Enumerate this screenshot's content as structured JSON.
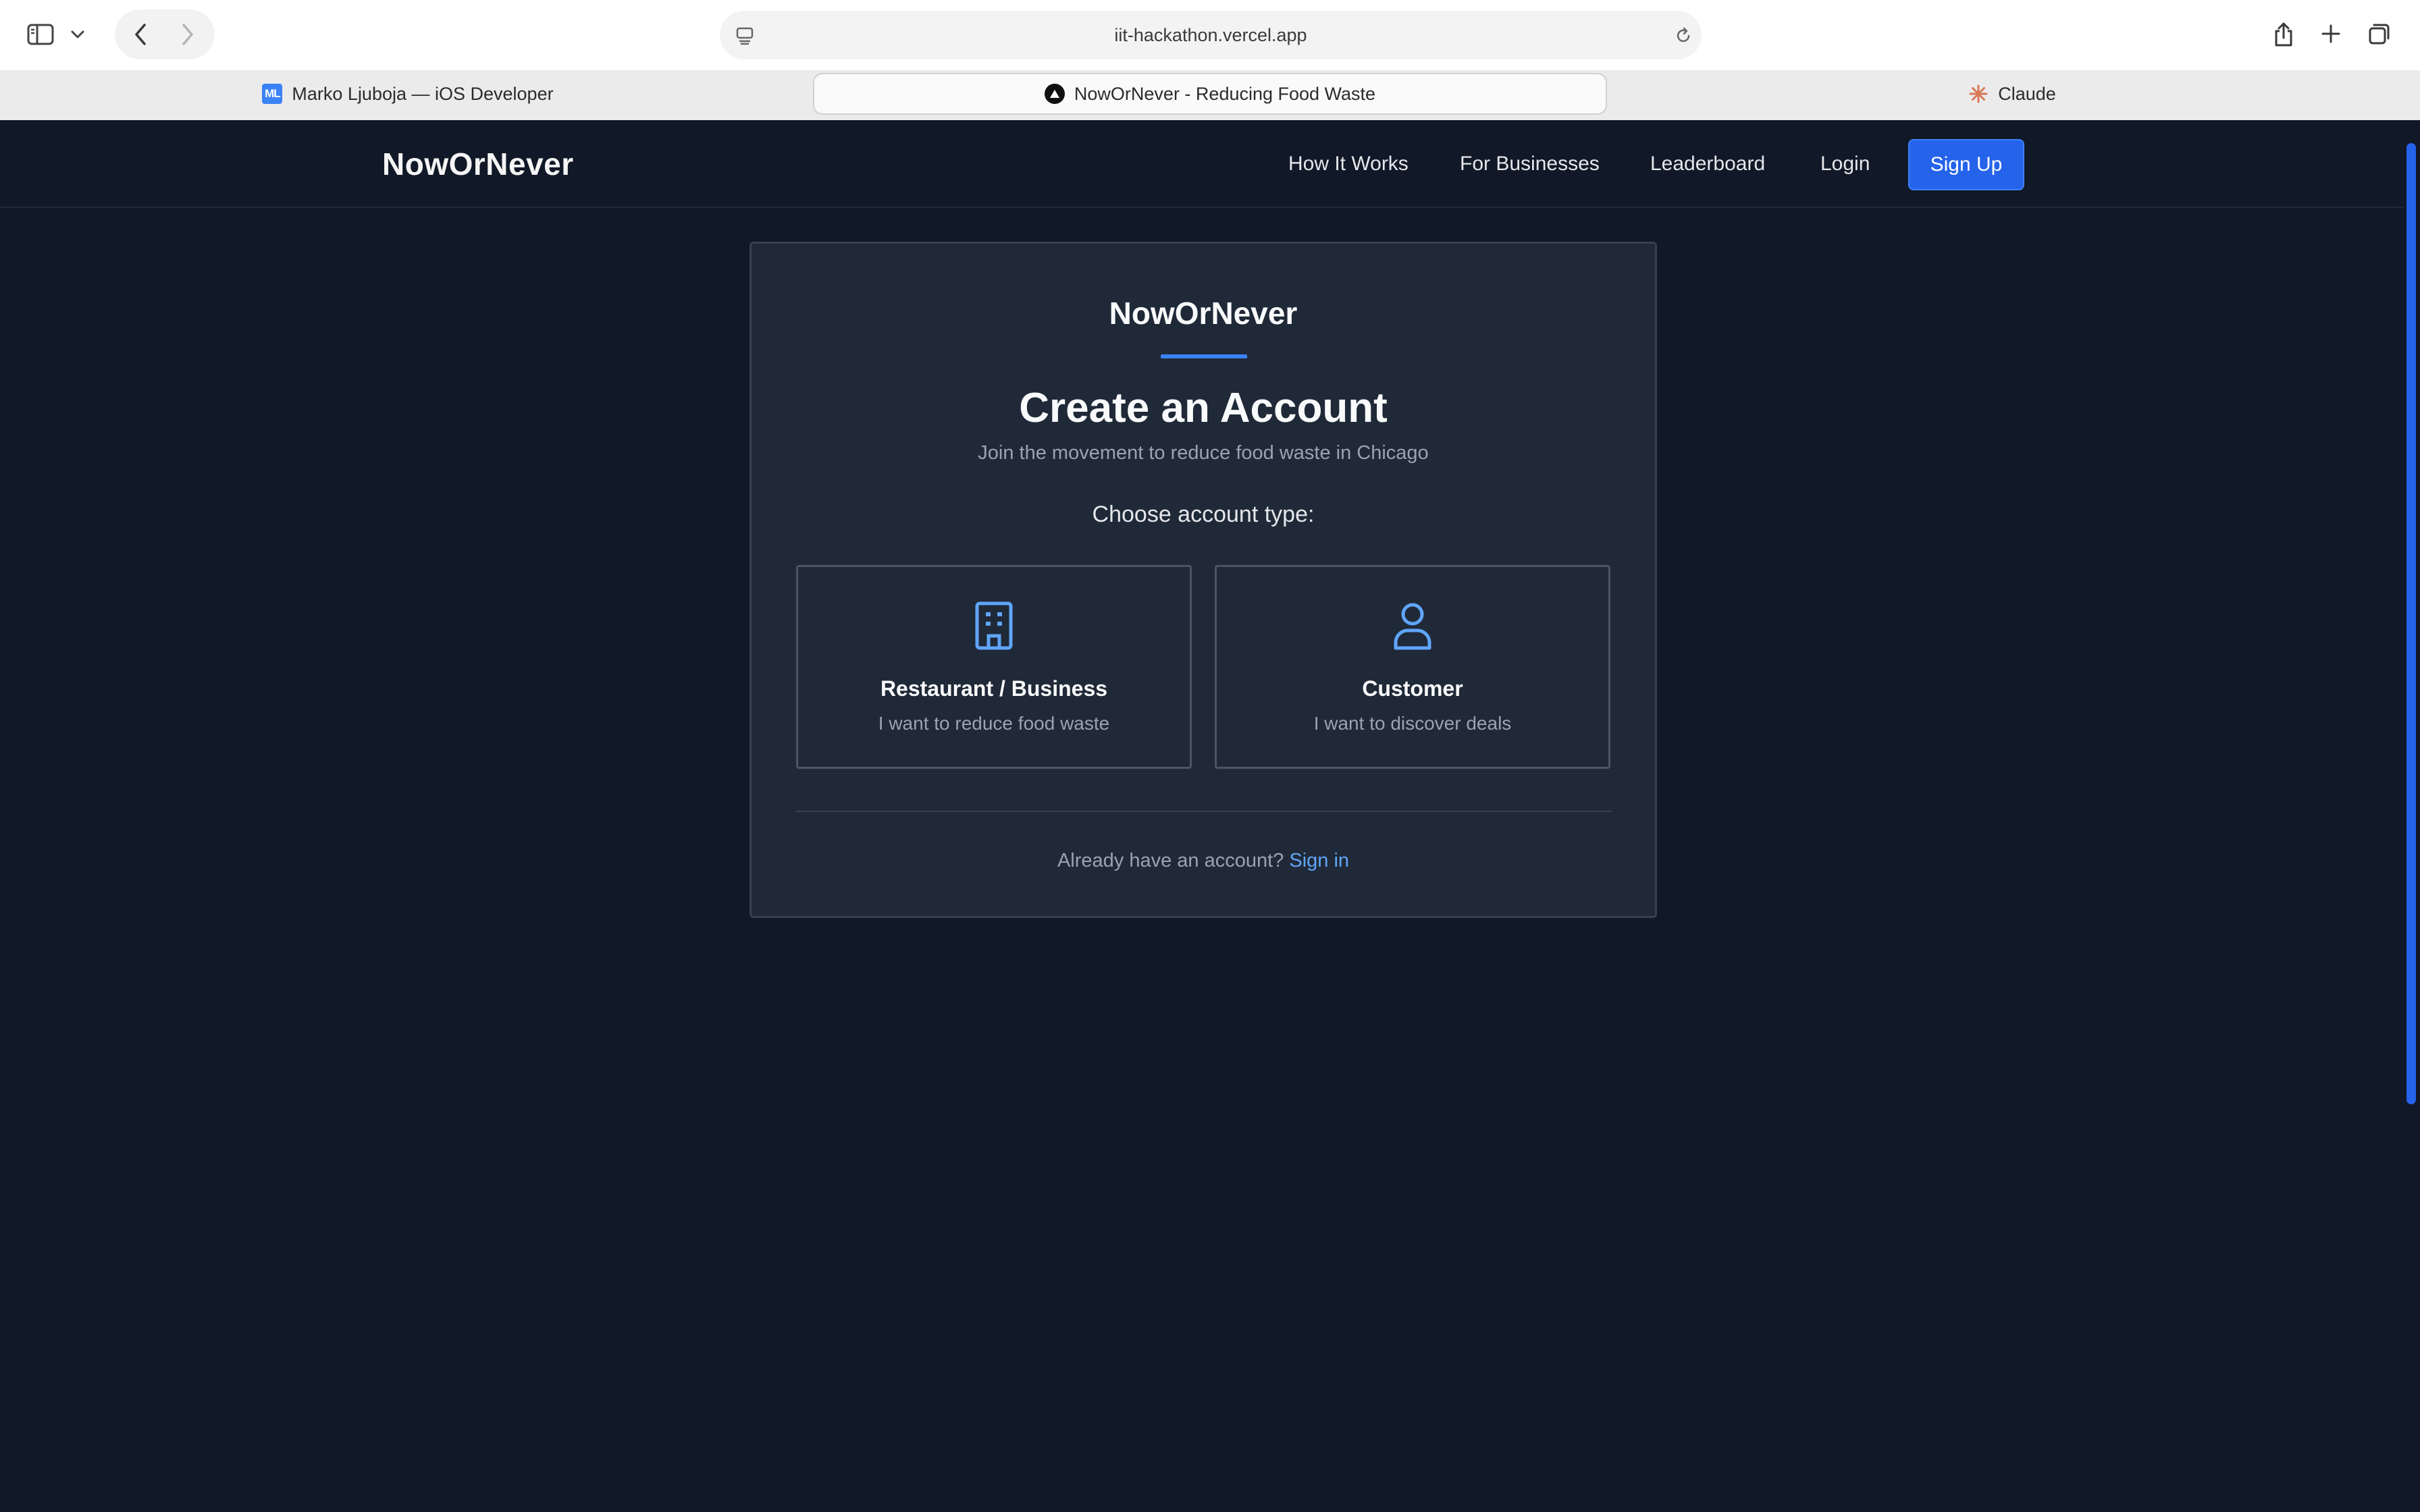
{
  "browser": {
    "url": "iit-hackathon.vercel.app",
    "tabs": [
      {
        "label": "Marko Ljuboja — iOS Developer",
        "favicon_text": "ML",
        "active": false
      },
      {
        "label": "NowOrNever - Reducing Food Waste",
        "active": true
      },
      {
        "label": "Claude",
        "active": false
      }
    ]
  },
  "nav": {
    "brand": "NowOrNever",
    "links": [
      "How It Works",
      "For Businesses",
      "Leaderboard",
      "Login"
    ],
    "signup": "Sign Up"
  },
  "card": {
    "brand": "NowOrNever",
    "title": "Create an Account",
    "subtitle": "Join the movement to reduce food waste in Chicago",
    "choose_label": "Choose account type:",
    "options": [
      {
        "title": "Restaurant / Business",
        "desc": "I want to reduce food waste",
        "icon": "building-icon"
      },
      {
        "title": "Customer",
        "desc": "I want to discover deals",
        "icon": "user-icon"
      }
    ],
    "footer_text": "Already have an account?",
    "footer_link": "Sign in"
  },
  "colors": {
    "page_bg": "#111827",
    "card_bg": "#1f2937",
    "accent": "#3b82f6",
    "primary_button": "#2563eb",
    "link": "#60a5fa"
  }
}
